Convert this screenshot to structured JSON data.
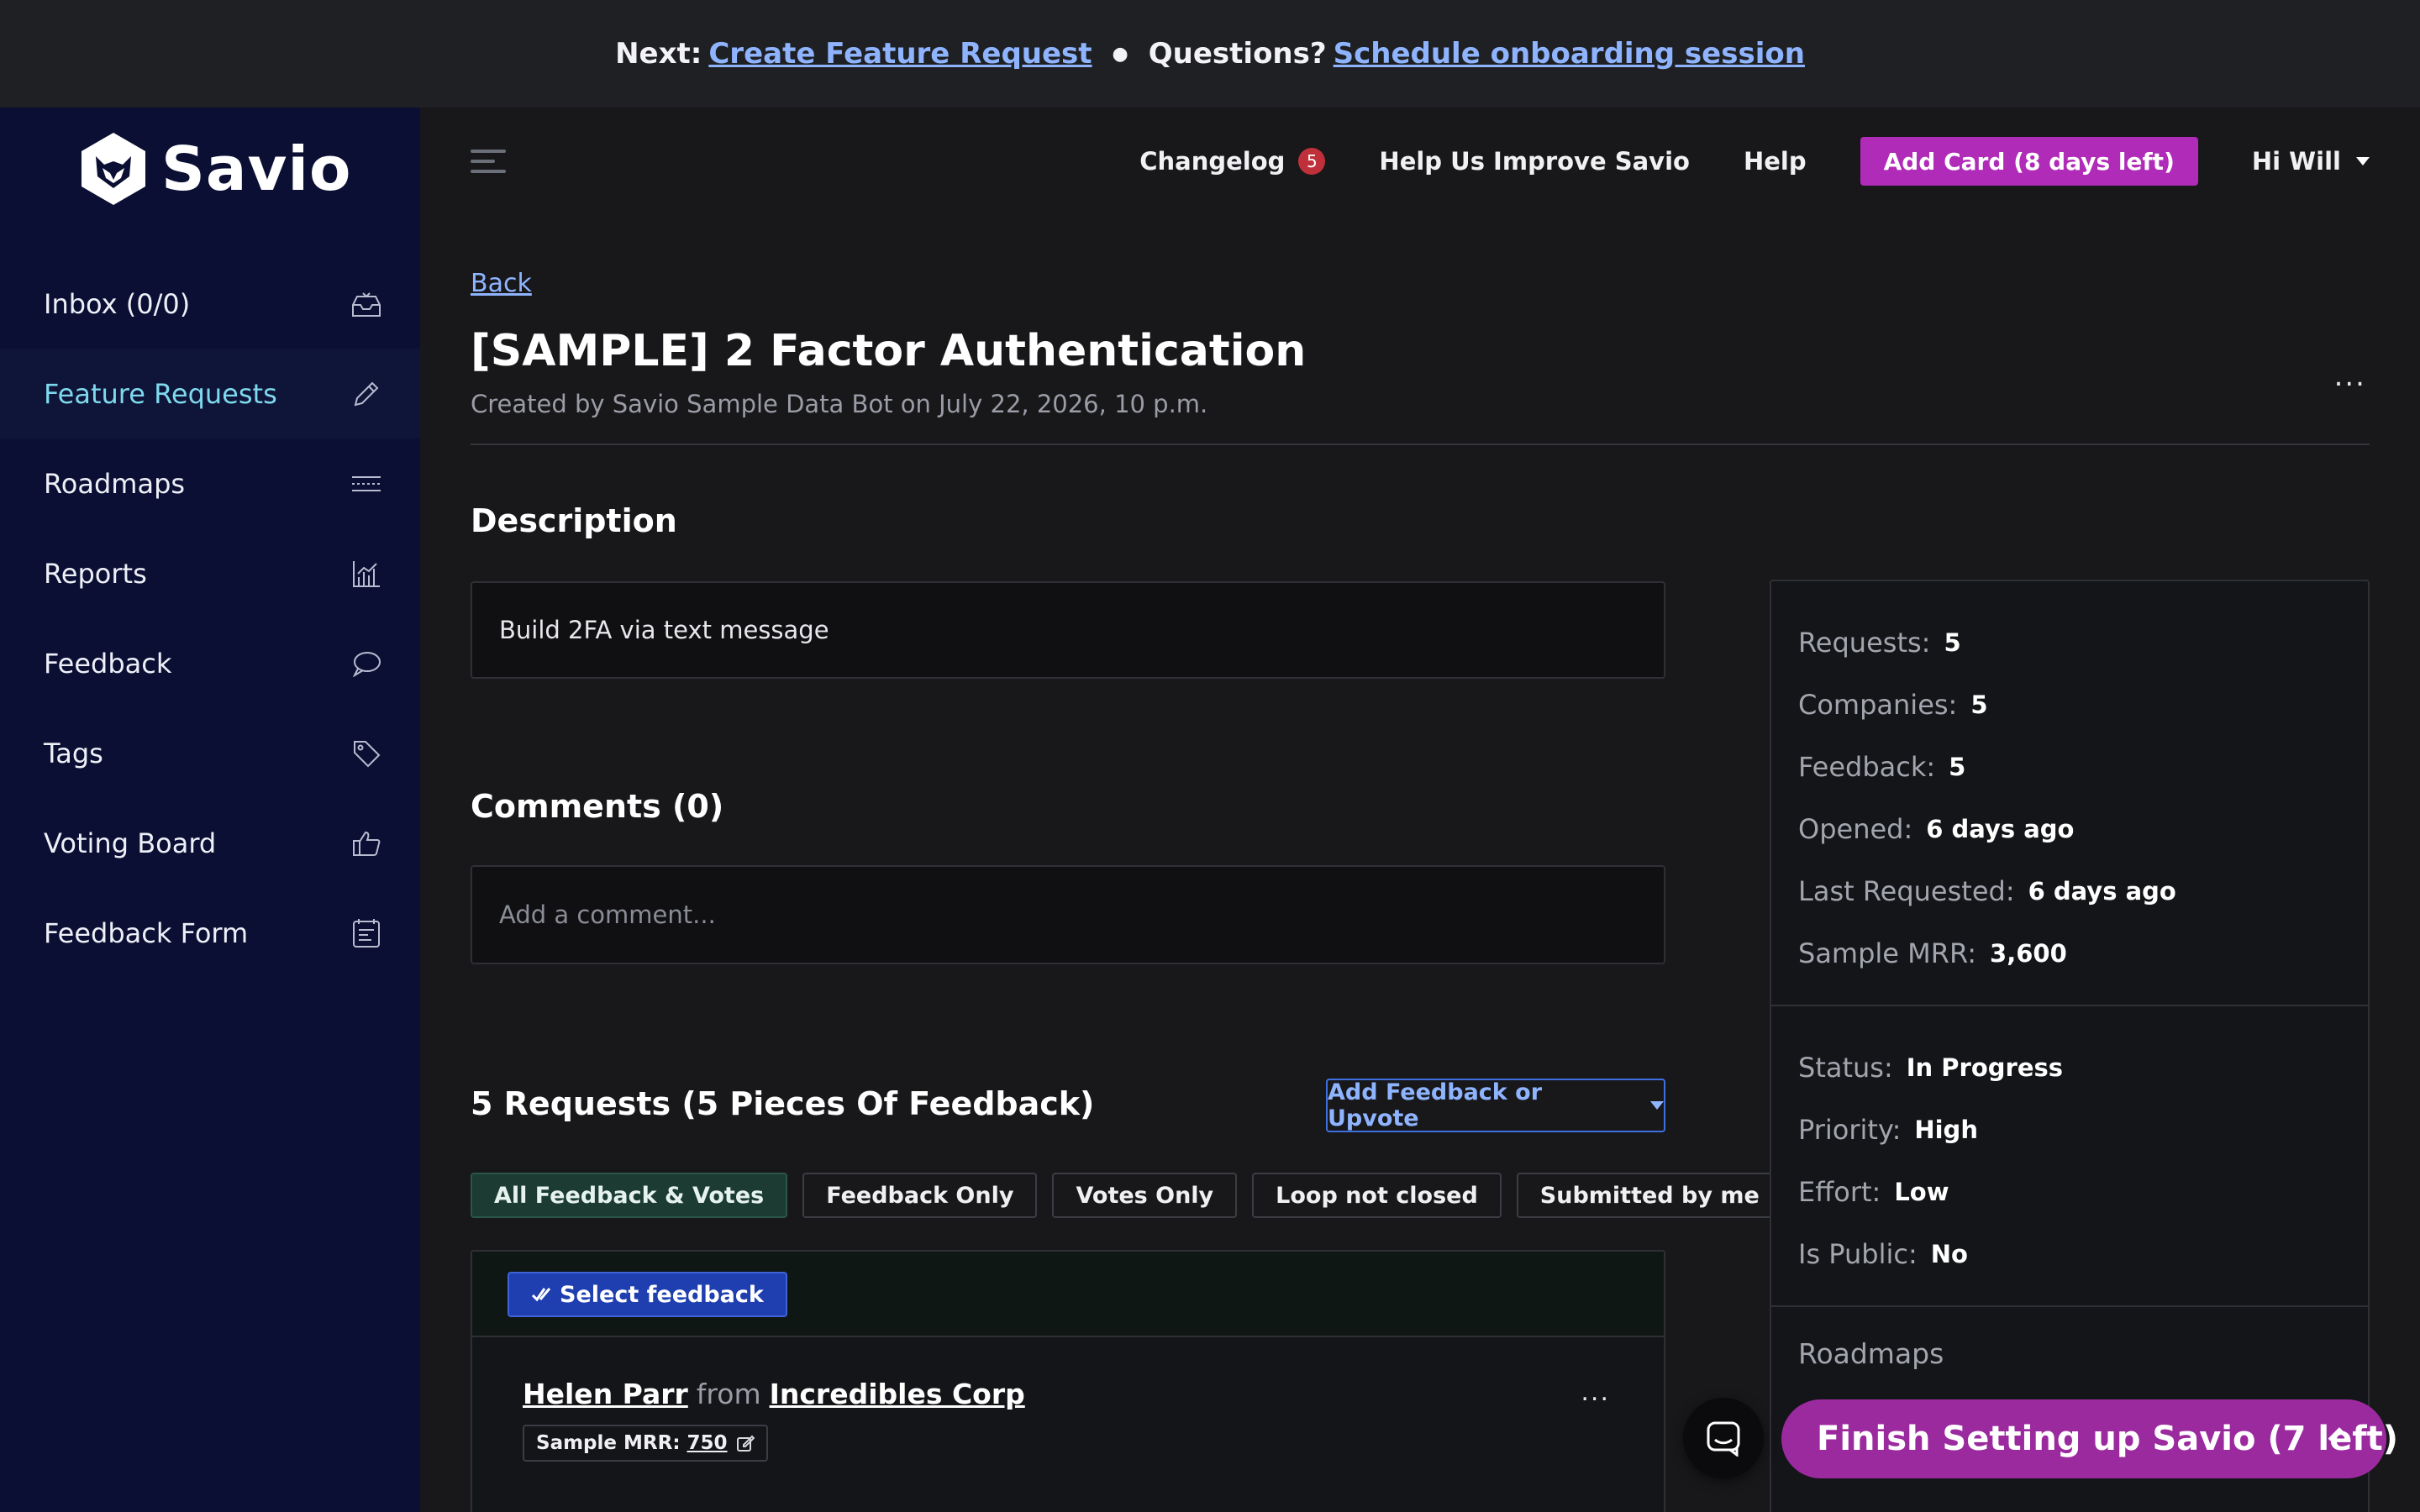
{
  "banner": {
    "next_label": "Next:",
    "next_link": "Create Feature Request",
    "questions_label": "Questions?",
    "questions_link": "Schedule onboarding session"
  },
  "brand": {
    "name": "Savio"
  },
  "sidebar": {
    "items": [
      {
        "label": "Inbox (0/0)",
        "icon": "inbox-icon"
      },
      {
        "label": "Feature Requests",
        "icon": "pencil-icon",
        "active": true
      },
      {
        "label": "Roadmaps",
        "icon": "roadmap-icon"
      },
      {
        "label": "Reports",
        "icon": "chart-icon"
      },
      {
        "label": "Feedback",
        "icon": "chat-bubble-icon"
      },
      {
        "label": "Tags",
        "icon": "tag-icon"
      },
      {
        "label": "Voting Board",
        "icon": "thumbs-up-icon"
      },
      {
        "label": "Feedback Form",
        "icon": "form-icon"
      }
    ]
  },
  "header": {
    "changelog": "Changelog",
    "changelog_count": "5",
    "improve": "Help Us Improve Savio",
    "help": "Help",
    "add_card": "Add Card (8 days left)",
    "user": "Hi Will"
  },
  "page": {
    "back": "Back",
    "title": "[SAMPLE] 2 Factor Authentication",
    "created": "Created by Savio Sample Data Bot on July 22, 2026, 10 p.m.",
    "more": "..."
  },
  "description": {
    "heading": "Description",
    "text": "Build 2FA via text message"
  },
  "comments": {
    "heading": "Comments (0)",
    "placeholder": "Add a comment..."
  },
  "requests": {
    "heading": "5 Requests (5 Pieces Of Feedback)",
    "add_button": "Add Feedback or Upvote",
    "filters": [
      "All Feedback & Votes",
      "Feedback Only",
      "Votes Only",
      "Loop not closed",
      "Submitted by me"
    ],
    "select_button": "Select feedback",
    "item": {
      "person": "Helen Parr",
      "from": "from",
      "company": "Incredibles Corp",
      "mrr_label": "Sample MRR:",
      "mrr_value": "750",
      "more": "..."
    }
  },
  "stats": {
    "rows": [
      {
        "k": "Requests:",
        "v": "5"
      },
      {
        "k": "Companies:",
        "v": "5"
      },
      {
        "k": "Feedback:",
        "v": "5"
      },
      {
        "k": "Opened:",
        "v": "6 days ago"
      },
      {
        "k": "Last Requested:",
        "v": "6 days ago"
      },
      {
        "k": "Sample MRR:",
        "v": "3,600"
      }
    ],
    "status_rows": [
      {
        "k": "Status:",
        "v": "In Progress"
      },
      {
        "k": "Priority:",
        "v": "High"
      },
      {
        "k": "Effort:",
        "v": "Low"
      },
      {
        "k": "Is Public:",
        "v": "No"
      }
    ],
    "roadmaps_label": "Roadmaps"
  },
  "finish": {
    "label": "Finish Setting up Savio (7 left)"
  },
  "colors": {
    "accent": "#b02bb8",
    "link": "#8fb4ff",
    "sidebar_bg": "#0b0f33",
    "active_nav": "#7fd9ee"
  }
}
